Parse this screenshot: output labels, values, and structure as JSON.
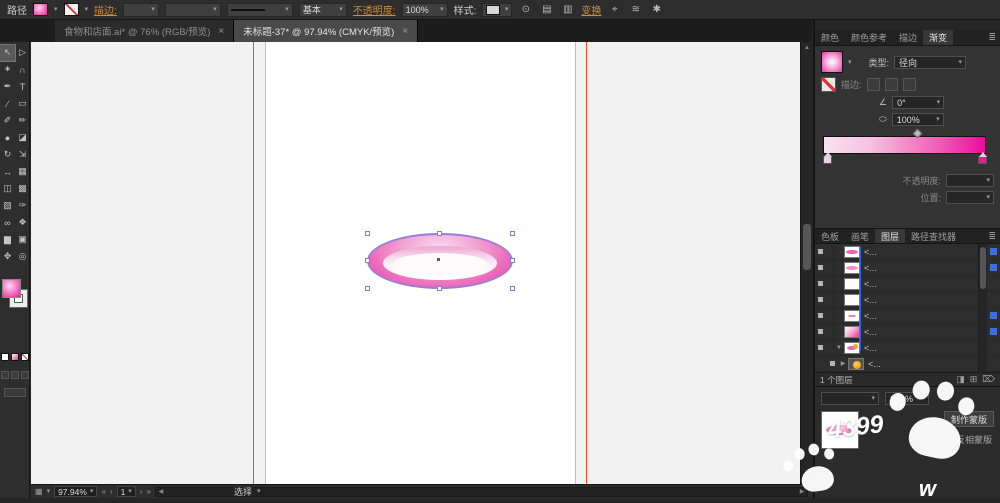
{
  "colors": {
    "accent": "#ec3fa8",
    "guide": "#ff4a21",
    "selection_blue": "#7e7ed2"
  },
  "icons": {
    "dd": "▾",
    "ddu": "▴",
    "menu": "≣",
    "close": "×",
    "first": "«",
    "prev": "‹",
    "next": "›",
    "last": "»",
    "left": "◀",
    "right": "▶",
    "up": "▲",
    "down": "▼",
    "grid": "▦",
    "circle": "⊙",
    "align1": "▤",
    "align2": "▥",
    "crosshair": "⌖",
    "waves": "≋",
    "star": "✱",
    "angle": "∠",
    "aspect": "⬭",
    "target": "○",
    "new_layer": "⊞",
    "sublayer": "◨",
    "trash": "⌦"
  },
  "control_bar": {
    "object_label": "路径",
    "stroke_link": "描边:",
    "brush_profile": "基本",
    "opacity_link": "不透明度:",
    "opacity_value": "100%",
    "style_label": "样式:",
    "transform_link": "变换"
  },
  "tabs": [
    {
      "title": "食物和店面.ai* @ 76% (RGB/预览)"
    },
    {
      "title": "未标题-37* @ 97.94% (CMYK/预览)"
    }
  ],
  "toolbar": {
    "tools": [
      {
        "name": "selection",
        "glyph": "↖"
      },
      {
        "name": "direct-selection",
        "glyph": "▷"
      },
      {
        "name": "magic-wand",
        "glyph": "✶"
      },
      {
        "name": "lasso",
        "glyph": "∩"
      },
      {
        "name": "pen",
        "glyph": "✒"
      },
      {
        "name": "type",
        "glyph": "T"
      },
      {
        "name": "line",
        "glyph": "∕"
      },
      {
        "name": "rectangle",
        "glyph": "▭"
      },
      {
        "name": "paintbrush",
        "glyph": "✐"
      },
      {
        "name": "pencil",
        "glyph": "✏"
      },
      {
        "name": "blob-brush",
        "glyph": "●"
      },
      {
        "name": "eraser",
        "glyph": "◪"
      },
      {
        "name": "rotate",
        "glyph": "↻"
      },
      {
        "name": "scale",
        "glyph": "⇲"
      },
      {
        "name": "width",
        "glyph": "↔"
      },
      {
        "name": "free-transform",
        "glyph": "▦"
      },
      {
        "name": "shape-builder",
        "glyph": "◫"
      },
      {
        "name": "mesh",
        "glyph": "▩"
      },
      {
        "name": "gradient",
        "glyph": "▧"
      },
      {
        "name": "eyedropper",
        "glyph": "✑"
      },
      {
        "name": "blend",
        "glyph": "∞"
      },
      {
        "name": "symbol",
        "glyph": "❖"
      },
      {
        "name": "graph",
        "glyph": "▆"
      },
      {
        "name": "artboard",
        "glyph": "▣"
      },
      {
        "name": "hand",
        "glyph": "✥"
      },
      {
        "name": "zoom",
        "glyph": "◎"
      }
    ]
  },
  "gradient_panel": {
    "tabs": [
      "颜色",
      "颜色参考",
      "描边",
      "渐变"
    ],
    "type_label": "类型:",
    "type_value": "径向",
    "stroke_label": "描边:",
    "angle_value": "0°",
    "aspect_value": "100%",
    "opacity_label": "不透明度:",
    "location_label": "位置:"
  },
  "panel_tabs2": [
    "色板",
    "画笔",
    "图层",
    "路径查找器"
  ],
  "layers": {
    "rows": [
      {
        "name": "<...",
        "expand": ""
      },
      {
        "name": "<...",
        "expand": ""
      },
      {
        "name": "<...",
        "expand": ""
      },
      {
        "name": "<...",
        "expand": ""
      },
      {
        "name": "<...",
        "expand": ""
      },
      {
        "name": "<...",
        "expand": ""
      },
      {
        "name": "<...",
        "expand": "▼"
      },
      {
        "name": "<...",
        "expand": "▶"
      }
    ],
    "footer": "1 个图层"
  },
  "transparency": {
    "opacity_value": "100%",
    "make_mask": "制作蒙版",
    "invert_mask": "反相蒙版"
  },
  "status_bar": {
    "zoom": "97.94%",
    "artboard": "1",
    "mode": "选择"
  },
  "watermark": {
    "text": "4399",
    "script": "w"
  }
}
